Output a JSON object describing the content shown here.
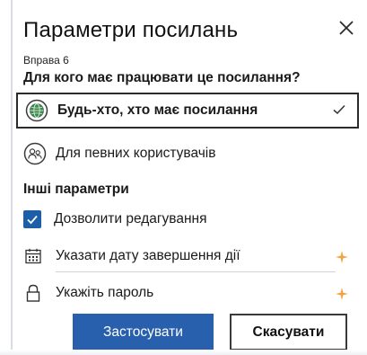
{
  "dialog": {
    "title": "Параметри посилань",
    "exercise_label": "Вправа 6",
    "question": "Для кого має працювати це посилання?"
  },
  "options": [
    {
      "label": "Будь-хто, хто має посилання",
      "icon": "globe-icon",
      "selected": true
    },
    {
      "label": "Для певних користувачів",
      "icon": "people-icon",
      "selected": false
    }
  ],
  "other_settings": {
    "heading": "Інші параметри",
    "allow_editing": {
      "label": "Дозволити редагування",
      "checked": true
    },
    "expiry_date": {
      "label": "Указати дату завершення дії",
      "icon": "calendar-icon",
      "premium": true
    },
    "password": {
      "label": "Укажіть пароль",
      "icon": "lock-icon",
      "premium": true
    }
  },
  "buttons": {
    "apply": "Застосувати",
    "cancel": "Скасувати"
  },
  "colors": {
    "accent": "#2860ad",
    "premium": "#f4a340",
    "border": "#2b2b2b"
  }
}
